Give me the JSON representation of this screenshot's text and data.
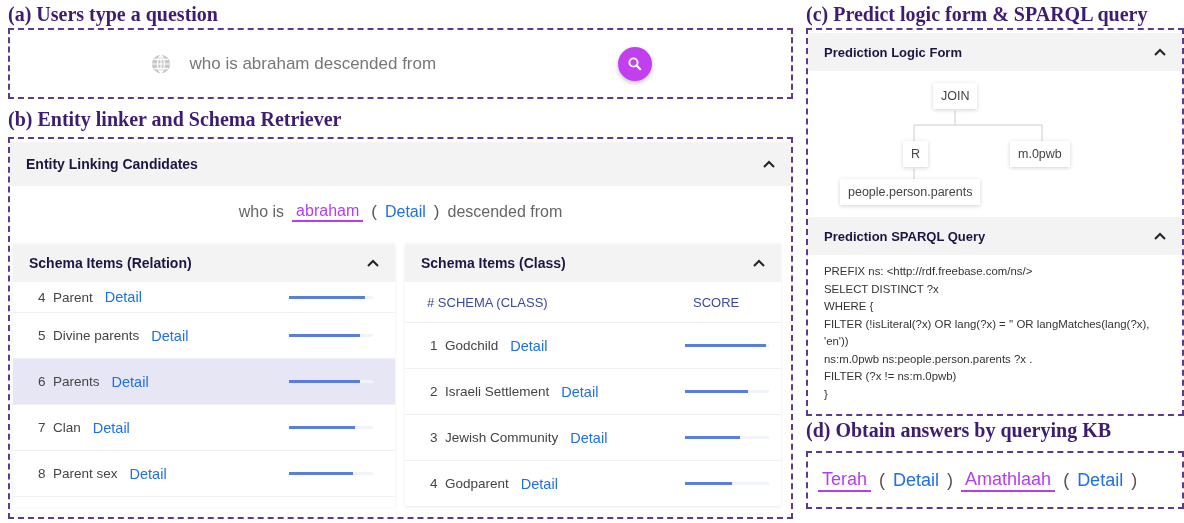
{
  "question_section": {
    "title": "(a) Users type a question",
    "search": {
      "value": "who is abraham descended from"
    }
  },
  "linker_section": {
    "title": "(b) Entity linker and Schema Retriever",
    "entity_panel": {
      "title": "Entity Linking Candidates",
      "expanded": true,
      "prefix": "who is",
      "entity": "abraham",
      "open_paren": "(",
      "link": "Detail",
      "close_paren": ")",
      "suffix": "descended from"
    },
    "relation_panel": {
      "title": "Schema Items (Relation)",
      "expanded": true,
      "rows": [
        {
          "index": "4",
          "name": "Parent",
          "link": "Detail",
          "level": 0.9,
          "selected": false
        },
        {
          "index": "5",
          "name": "Divine parents",
          "link": "Detail",
          "level": 0.85,
          "selected": false
        },
        {
          "index": "6",
          "name": "Parents",
          "link": "Detail",
          "level": 0.85,
          "selected": true
        },
        {
          "index": "7",
          "name": "Clan",
          "link": "Detail",
          "level": 0.78,
          "selected": false
        },
        {
          "index": "8",
          "name": "Parent sex",
          "link": "Detail",
          "level": 0.76,
          "selected": false
        }
      ]
    },
    "class_panel": {
      "title": "Schema Items (Class)",
      "expanded": true,
      "columns": [
        "# SCHEMA (CLASS)",
        "SCORE"
      ],
      "rows": [
        {
          "index": "1",
          "name": "Godchild",
          "link": "Detail",
          "level": 0.96,
          "selected": false
        },
        {
          "index": "2",
          "name": "Israeli Settlement",
          "link": "Detail",
          "level": 0.75,
          "selected": false
        },
        {
          "index": "3",
          "name": "Jewish Community",
          "link": "Detail",
          "level": 0.65,
          "selected": false
        },
        {
          "index": "4",
          "name": "Godparent",
          "link": "Detail",
          "level": 0.56,
          "selected": false
        }
      ]
    }
  },
  "prediction_section": {
    "title": "(c) Predict logic form & SPARQL query",
    "logic_panel": {
      "title": "Prediction Logic Form",
      "expanded": true,
      "tree": {
        "label": "JOIN",
        "children": [
          {
            "label": "R",
            "children": [
              {
                "label": "people.person.parents"
              }
            ]
          },
          {
            "label": "m.0pwb"
          }
        ]
      }
    },
    "sparql_panel": {
      "title": "Prediction SPARQL Query",
      "expanded": true,
      "lines": [
        "PREFIX ns: <http://rdf.freebase.com/ns/>",
        "SELECT DISTINCT ?x",
        "WHERE {",
        "FILTER (!isLiteral(?x) OR lang(?x) = '' OR langMatches(lang(?x), 'en'))",
        "ns:m.0pwb ns:people.person.parents ?x .",
        "FILTER (?x != ns:m.0pwb)",
        "}"
      ]
    }
  },
  "answer_section": {
    "title": "(d) Obtain answers by querying KB",
    "answers": [
      {
        "name": "Terah",
        "open_paren": "(",
        "link": "Detail",
        "close_paren": ")"
      },
      {
        "name": "Amathlaah",
        "open_paren": "(",
        "link": "Detail",
        "close_paren": ")"
      }
    ]
  }
}
